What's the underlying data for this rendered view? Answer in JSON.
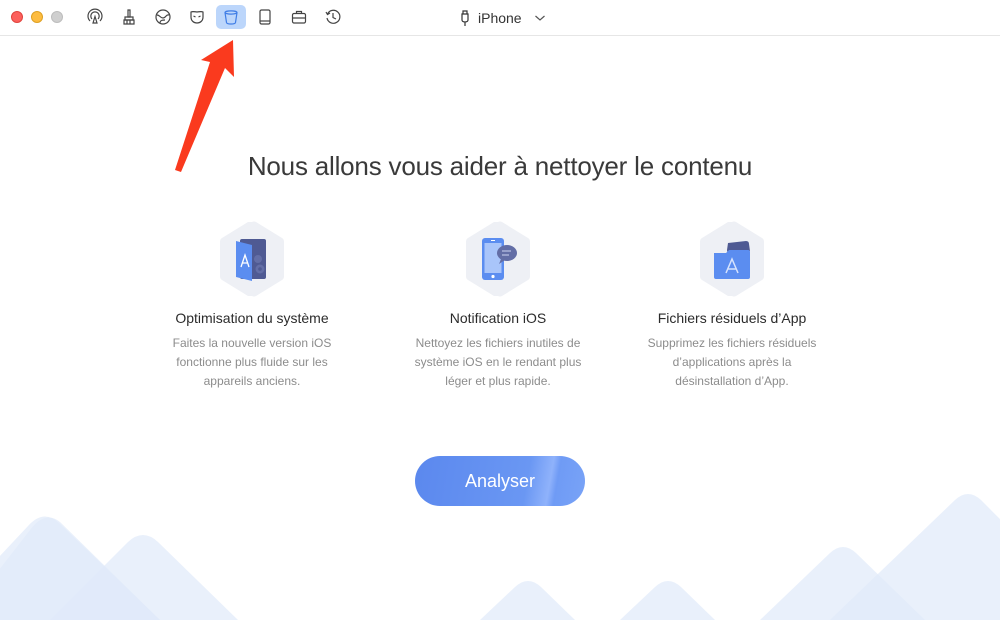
{
  "window": {
    "traffic_lights": [
      "close",
      "minimize",
      "maximize"
    ]
  },
  "toolbar": {
    "tools": [
      {
        "name": "airbackup",
        "icon": "airplay-icon",
        "active": false
      },
      {
        "name": "cleaner",
        "icon": "brush-icon",
        "active": false
      },
      {
        "name": "browser",
        "icon": "globe-icon",
        "active": false
      },
      {
        "name": "privacy",
        "icon": "mask-icon",
        "active": false
      },
      {
        "name": "clean-content",
        "icon": "bucket-icon",
        "active": true
      },
      {
        "name": "device",
        "icon": "tablet-icon",
        "active": false
      },
      {
        "name": "toolkit",
        "icon": "briefcase-icon",
        "active": false
      },
      {
        "name": "history",
        "icon": "history-icon",
        "active": false
      }
    ],
    "device_label": "iPhone"
  },
  "main": {
    "headline": "Nous allons vous aider à nettoyer le contenu",
    "features": [
      {
        "icon": "system-optimize-icon",
        "title": "Optimisation du système",
        "lines": [
          "Faites la nouvelle version iOS",
          "fonctionne plus fluide sur les",
          "appareils anciens."
        ]
      },
      {
        "icon": "ios-notification-icon",
        "title": "Notification iOS",
        "lines": [
          "Nettoyez les fichiers inutiles de",
          "système iOS en le rendant plus",
          "léger et plus rapide."
        ]
      },
      {
        "icon": "app-residue-icon",
        "title": "Fichiers résiduels d’App",
        "lines": [
          "Supprimez les fichiers résiduels",
          "d’applications après la",
          "désinstallation d’App."
        ]
      }
    ],
    "analyse_label": "Analyser"
  },
  "colors": {
    "accent": "#5b88ee",
    "active_tool_bg": "#bcd6fb",
    "annotation_arrow": "#fa3a1e",
    "hex_bg": "#eef0f5",
    "mountain": "#e6effb"
  }
}
